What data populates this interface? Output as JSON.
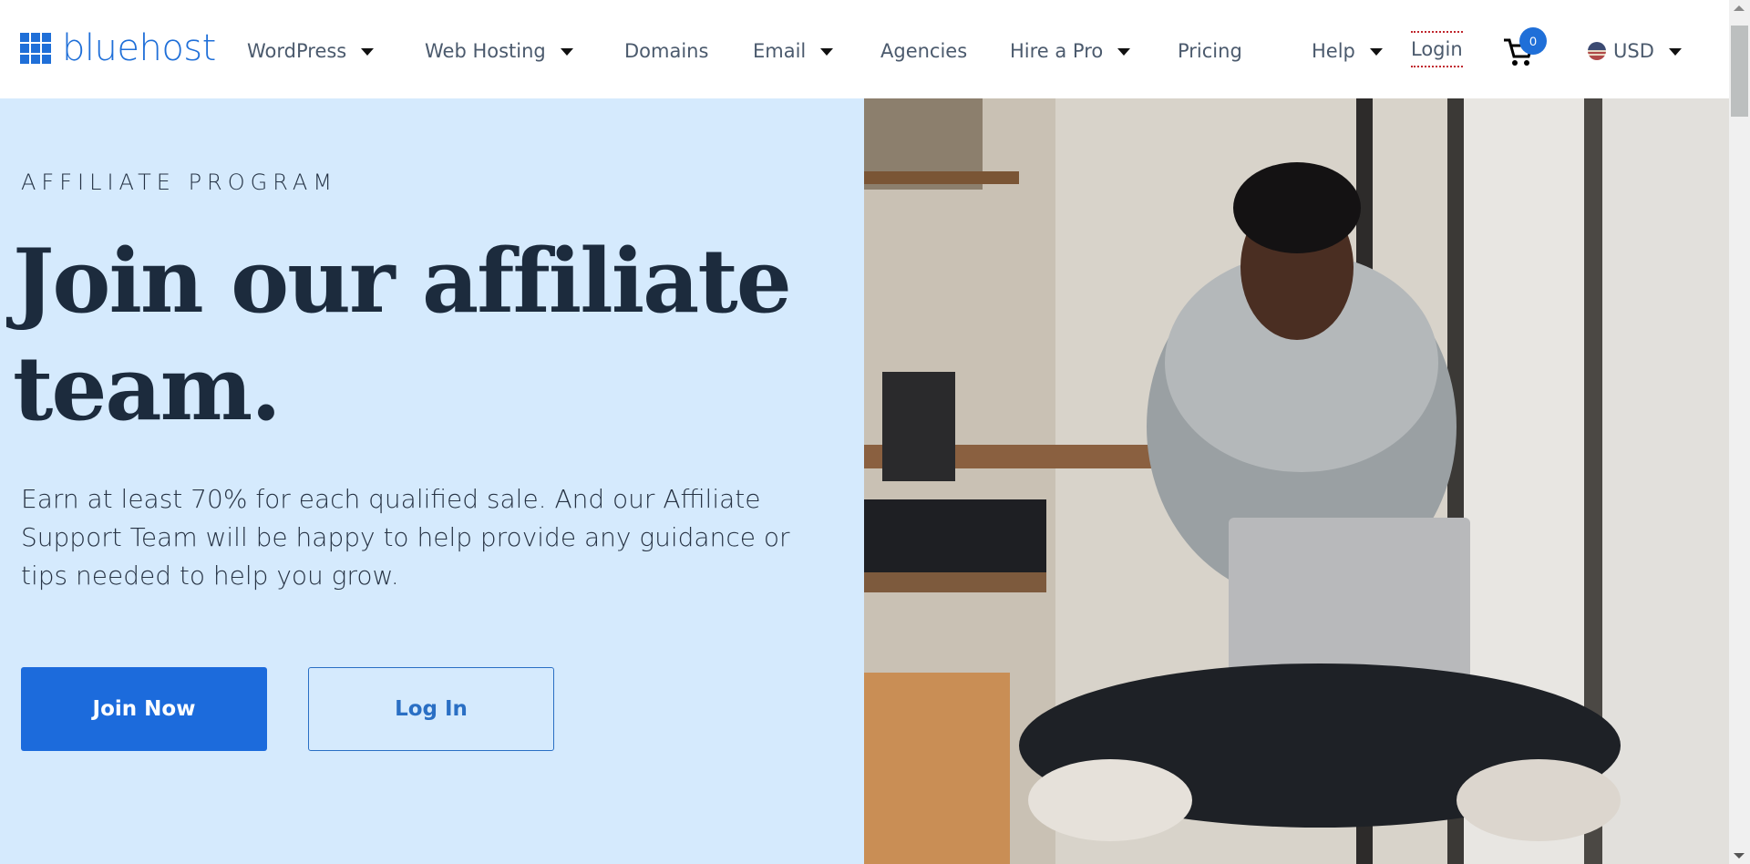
{
  "brand": {
    "name": "bluehost",
    "color": "#1f6fd8"
  },
  "nav": {
    "items": [
      {
        "label": "WordPress",
        "has_dropdown": true
      },
      {
        "label": "Web Hosting",
        "has_dropdown": true
      },
      {
        "label": "Domains",
        "has_dropdown": false
      },
      {
        "label": "Email",
        "has_dropdown": true
      },
      {
        "label": "Agencies",
        "has_dropdown": false
      },
      {
        "label": "Hire a Pro",
        "has_dropdown": true
      },
      {
        "label": "Pricing",
        "has_dropdown": false
      },
      {
        "label": "Help",
        "has_dropdown": true
      }
    ],
    "login_label": "Login",
    "cart_count": "0",
    "currency": "USD"
  },
  "hero": {
    "eyebrow": "AFFILIATE PROGRAM",
    "headline": "Join our affiliate team.",
    "body": "Earn at least 70% for each qualified sale. And our Affiliate Support Team will be happy to help provide any guidance or tips needed to help you grow.",
    "primary_button": "Join Now",
    "secondary_button": "Log In",
    "image_alt": "Man sitting cross-legged on a bench using a laptop"
  },
  "colors": {
    "hero_background": "#d5eafd",
    "primary_button": "#1c6bdc",
    "headline": "#1c2b3d",
    "login_underline": "#c0262d"
  }
}
